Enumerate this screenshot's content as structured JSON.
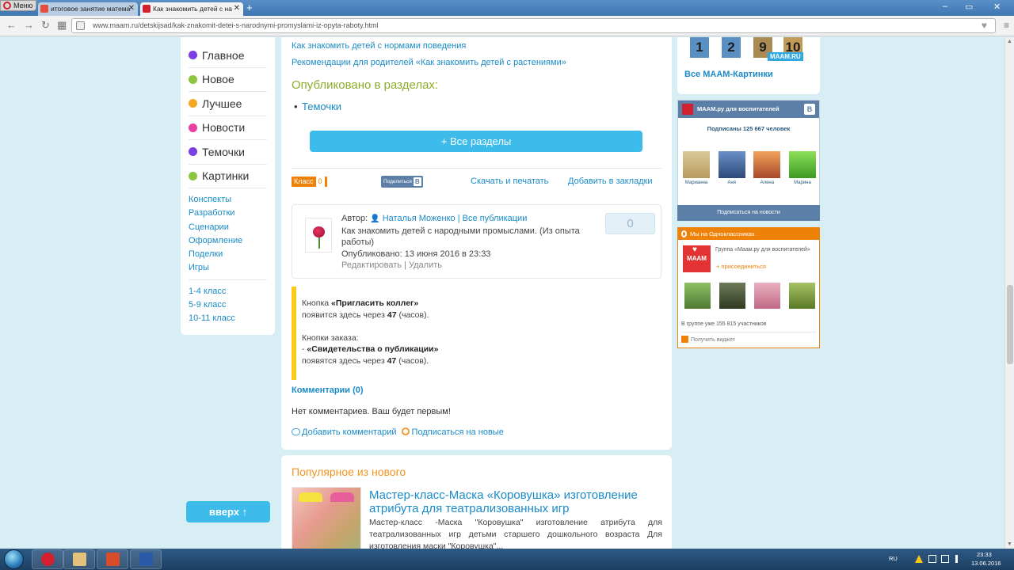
{
  "browser": {
    "menu_label": "Меню",
    "tabs": [
      {
        "title": "итоговое занятие матема",
        "active": false
      },
      {
        "title": "Как знакомить детей с на",
        "active": true
      }
    ],
    "new_tab": "+",
    "url": "www.maam.ru/detskijsad/kak-znakomit-detei-s-narodnymi-promyslami-iz-opyta-raboty.html",
    "win_min": "–",
    "win_max": "▭",
    "win_close": "✕"
  },
  "left_nav": {
    "main_items": [
      {
        "label": "Главное",
        "color": "#7b3fe4"
      },
      {
        "label": "Новое",
        "color": "#8cc63f"
      },
      {
        "label": "Лучшее",
        "color": "#f5a623"
      },
      {
        "label": "Новости",
        "color": "#e93fa3"
      },
      {
        "label": "Темочки",
        "color": "#7b3fe4"
      },
      {
        "label": "Картинки",
        "color": "#8cc63f"
      }
    ],
    "sub_items": [
      "Конспекты",
      "Разработки",
      "Сценарии",
      "Оформление",
      "Поделки",
      "Игры"
    ],
    "grades": [
      "1-4 класс",
      "5-9 класс",
      "10-11 класс"
    ],
    "up_button": "вверх ↑"
  },
  "content": {
    "related_links": [
      "Как знакомить детей с нормами поведения",
      "Рекомендации для родителей «Как знакомить детей с растениями»"
    ],
    "published_header": "Опубликовано в разделах:",
    "sections": [
      "Темочки"
    ],
    "all_sections_button": "+ Все разделы",
    "share": {
      "ok_label": "Класс",
      "ok_count": "0",
      "vk_label": "Поделиться",
      "vk_letter": "В",
      "download_print": "Скачать и печатать",
      "bookmark": "Добавить в закладки"
    },
    "author_card": {
      "author_prefix": "Автор:",
      "author_name": "Наталья Моженко",
      "separator": "|",
      "all_pubs": "Все публикации",
      "title": "Как знакомить детей с народными промыслами. (Из опыта работы)",
      "published": "Опубликовано: 13 июня 2016 в 23:33",
      "edit": "Редактировать",
      "delete": "Удалить",
      "votes": "0"
    },
    "notice": {
      "line1_prefix": "Кнопка ",
      "line1_bold": "«Пригласить коллег»",
      "line2_prefix": "появится здесь через ",
      "line2_hours": "47",
      "line2_suffix": " (часов).",
      "line3": "Кнопки заказа:",
      "line4_prefix": "- ",
      "line4_bold": "«Свидетельства о публикации»",
      "line5_prefix": "появятся здесь через ",
      "line5_hours": "47",
      "line5_suffix": " (часов)."
    },
    "comments_link": "Комментарии (0)",
    "no_comments": "Нет комментариев. Ваш будет первым!",
    "add_comment": "Добавить комментарий",
    "subscribe_new": "Подписаться на новые"
  },
  "popular": {
    "title": "Популярное из нового",
    "item_title": "Мастер-класс-Маска «Коровушка» изготовление атрибута для театрализованных игр",
    "item_desc": "Мастер-класс -Маска \"Коровушка\" изготовление атрибута для театрализованных игр детьми старшего дошкольного возраста Для изготовления маски \"Коровушка\"..."
  },
  "right": {
    "picture_numbers": [
      "1",
      "2",
      "9",
      "10"
    ],
    "maam_badge": "MAAM.RU",
    "all_pictures": "Все МААМ-Картинки",
    "vk_widget": {
      "title": "МААМ.ру для воспитателей",
      "vk_letter": "В",
      "subscribers": "Подписаны 125 667 человек",
      "people": [
        {
          "name": "Марианна",
          "color": "#c9b27a"
        },
        {
          "name": "Аня",
          "color": "#3b5f9a"
        },
        {
          "name": "Алена",
          "color": "#e07a3c"
        },
        {
          "name": "Марина",
          "color": "#5fc43a"
        }
      ],
      "subscribe_button": "Подписаться на новости"
    },
    "ok_widget": {
      "title": "Мы на Одноклассниках",
      "group_logo": "МААМ",
      "group_name": "Группа «Маам.ру для воспитателей»",
      "join": "+ присоединиться",
      "photo_colors": [
        "#6c9a4c",
        "#4a5a3a",
        "#d58aa0",
        "#7c9a3c"
      ],
      "members": "В группе уже 155 815 участников",
      "get_widget": "Получить виджет"
    }
  },
  "taskbar": {
    "lang": "RU",
    "time": "23:33",
    "date": "13.06.2016",
    "app_colors": [
      "#d2202f",
      "#e3c07b",
      "#d94c2a",
      "#2b5aa6"
    ]
  }
}
